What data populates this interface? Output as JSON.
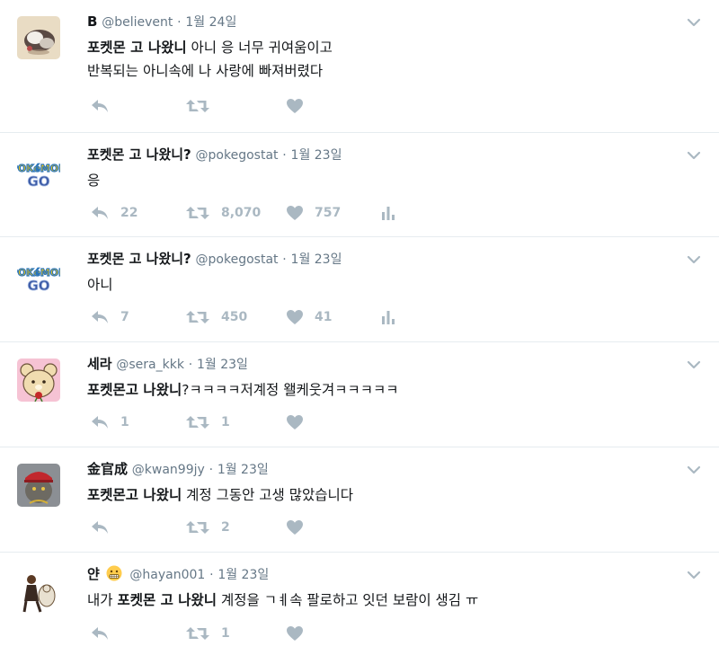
{
  "colors": {
    "icon": "#aab8c2",
    "muted": "#657786",
    "text": "#14171a",
    "divider": "#e6ecf0"
  },
  "tweets": [
    {
      "fullname": "B",
      "username": "@believent",
      "time": "1월 24일",
      "text_bold": "포켓몬 고 나왔니",
      "text_rest": " 아니 응 너무 귀여움이고\n반복되는 아니속에 나 사랑에 빠져버렸다",
      "text_pre": "",
      "counts": {
        "reply": "",
        "retweet": "",
        "like": ""
      },
      "analytics": false
    },
    {
      "fullname": "포켓몬 고 나왔니?",
      "username": "@pokegostat",
      "time": "1월 23일",
      "text_pre": "",
      "text_bold": "",
      "text_rest": "응",
      "counts": {
        "reply": "22",
        "retweet": "8,070",
        "like": "757"
      },
      "analytics": true
    },
    {
      "fullname": "포켓몬 고 나왔니?",
      "username": "@pokegostat",
      "time": "1월 23일",
      "text_pre": "",
      "text_bold": "",
      "text_rest": "아니",
      "counts": {
        "reply": "7",
        "retweet": "450",
        "like": "41"
      },
      "analytics": true
    },
    {
      "fullname": "세라",
      "username": "@sera_kkk",
      "time": "1월 23일",
      "text_pre": "",
      "text_bold": "포켓몬고 나왔니",
      "text_rest": "?ㅋㅋㅋㅋ저계정 왤케웃겨ㅋㅋㅋㅋㅋ",
      "counts": {
        "reply": "1",
        "retweet": "1",
        "like": ""
      },
      "analytics": false
    },
    {
      "fullname": "金官成",
      "username": "@kwan99jy",
      "time": "1월 23일",
      "text_pre": "",
      "text_bold": "포켓몬고 나왔니",
      "text_rest": " 계정 그동안 고생 많았습니다",
      "counts": {
        "reply": "",
        "retweet": "2",
        "like": ""
      },
      "analytics": false
    },
    {
      "fullname": "얀",
      "username": "@hayan001",
      "time": "1월 23일",
      "text_pre": "내가 ",
      "text_bold": "포켓몬 고 나왔니",
      "text_rest": " 계정을 ㄱㅖ속 팔로하고 잇던 보람이 생김 ㅠ",
      "counts": {
        "reply": "",
        "retweet": "1",
        "like": ""
      },
      "analytics": false
    }
  ],
  "separator": "·",
  "icons": [
    "reply-icon",
    "retweet-icon",
    "like-icon",
    "analytics-icon",
    "chevron-down-icon",
    "grimace-emoji"
  ],
  "avatar_logo_text": {
    "top": "POKéMON",
    "bottom": "GO"
  }
}
